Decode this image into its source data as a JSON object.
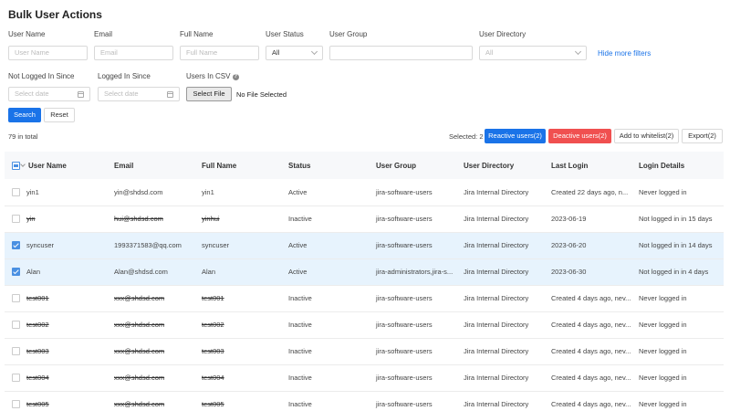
{
  "title": "Bulk User Actions",
  "filters": {
    "username_label": "User Name",
    "username_placeholder": "User Name",
    "email_label": "Email",
    "email_placeholder": "Email",
    "fullname_label": "Full Name",
    "fullname_placeholder": "Full Name",
    "status_label": "User Status",
    "status_value": "All",
    "group_label": "User Group",
    "directory_label": "User Directory",
    "directory_value": "All",
    "hide_more": "Hide more filters",
    "not_logged_label": "Not Logged In Since",
    "not_logged_placeholder": "Select date",
    "logged_label": "Logged In Since",
    "logged_placeholder": "Select date",
    "csv_label": "Users In CSV",
    "select_file": "Select File",
    "no_file": "No File Selected",
    "search": "Search",
    "reset": "Reset"
  },
  "toolbar": {
    "total": "79 in total",
    "selected": "Selected: 2",
    "reactive": "Reactive users(2)",
    "deactive": "Deactive users(2)",
    "whitelist": "Add to whitelist(2)",
    "export": "Export(2)"
  },
  "columns": [
    "User Name",
    "Email",
    "Full Name",
    "Status",
    "User Group",
    "User Directory",
    "Last Login",
    "Login Details"
  ],
  "rows": [
    {
      "name": "yin1",
      "email": "yin@shdsd.com",
      "full": "yin1",
      "status": "Active",
      "group": "jira-software-users",
      "dir": "Jira Internal Directory",
      "last": "Created 22 days ago, n...",
      "details": "Never logged in",
      "checked": false,
      "strike": false
    },
    {
      "name": "yin",
      "email": "hui@shdsd.com",
      "full": "yinhui",
      "status": "Inactive",
      "group": "jira-software-users",
      "dir": "Jira Internal Directory",
      "last": "2023-06-19",
      "details": "Not logged in in 15 days",
      "checked": false,
      "strike": true
    },
    {
      "name": "syncuser",
      "email": "1993371583@qq.com",
      "full": "syncuser",
      "status": "Active",
      "group": "jira-software-users",
      "dir": "Jira Internal Directory",
      "last": "2023-06-20",
      "details": "Not logged in in 14 days",
      "checked": true,
      "strike": false
    },
    {
      "name": "Alan",
      "email": "Alan@shdsd.com",
      "full": "Alan",
      "status": "Active",
      "group": "jira-administrators,jira-s...",
      "dir": "Jira Internal Directory",
      "last": "2023-06-30",
      "details": "Not logged in in 4 days",
      "checked": true,
      "strike": false
    },
    {
      "name": "test001",
      "email": "xxx@shdsd.com",
      "full": "test001",
      "status": "Inactive",
      "group": "jira-software-users",
      "dir": "Jira Internal Directory",
      "last": "Created 4 days ago, nev...",
      "details": "Never logged in",
      "checked": false,
      "strike": true
    },
    {
      "name": "test002",
      "email": "xxx@shdsd.com",
      "full": "test002",
      "status": "Inactive",
      "group": "jira-software-users",
      "dir": "Jira Internal Directory",
      "last": "Created 4 days ago, nev...",
      "details": "Never logged in",
      "checked": false,
      "strike": true
    },
    {
      "name": "test003",
      "email": "xxx@shdsd.com",
      "full": "test003",
      "status": "Inactive",
      "group": "jira-software-users",
      "dir": "Jira Internal Directory",
      "last": "Created 4 days ago, nev...",
      "details": "Never logged in",
      "checked": false,
      "strike": true
    },
    {
      "name": "test004",
      "email": "xxx@shdsd.com",
      "full": "test004",
      "status": "Inactive",
      "group": "jira-software-users",
      "dir": "Jira Internal Directory",
      "last": "Created 4 days ago, nev...",
      "details": "Never logged in",
      "checked": false,
      "strike": true
    },
    {
      "name": "test005",
      "email": "xxx@shdsd.com",
      "full": "test005",
      "status": "Inactive",
      "group": "jira-software-users",
      "dir": "Jira Internal Directory",
      "last": "Created 4 days ago, nev...",
      "details": "Never logged in",
      "checked": false,
      "strike": true
    }
  ],
  "colors": {
    "primary": "#1a73e8",
    "danger": "#f05050",
    "selected_row": "#e7f3fd"
  }
}
